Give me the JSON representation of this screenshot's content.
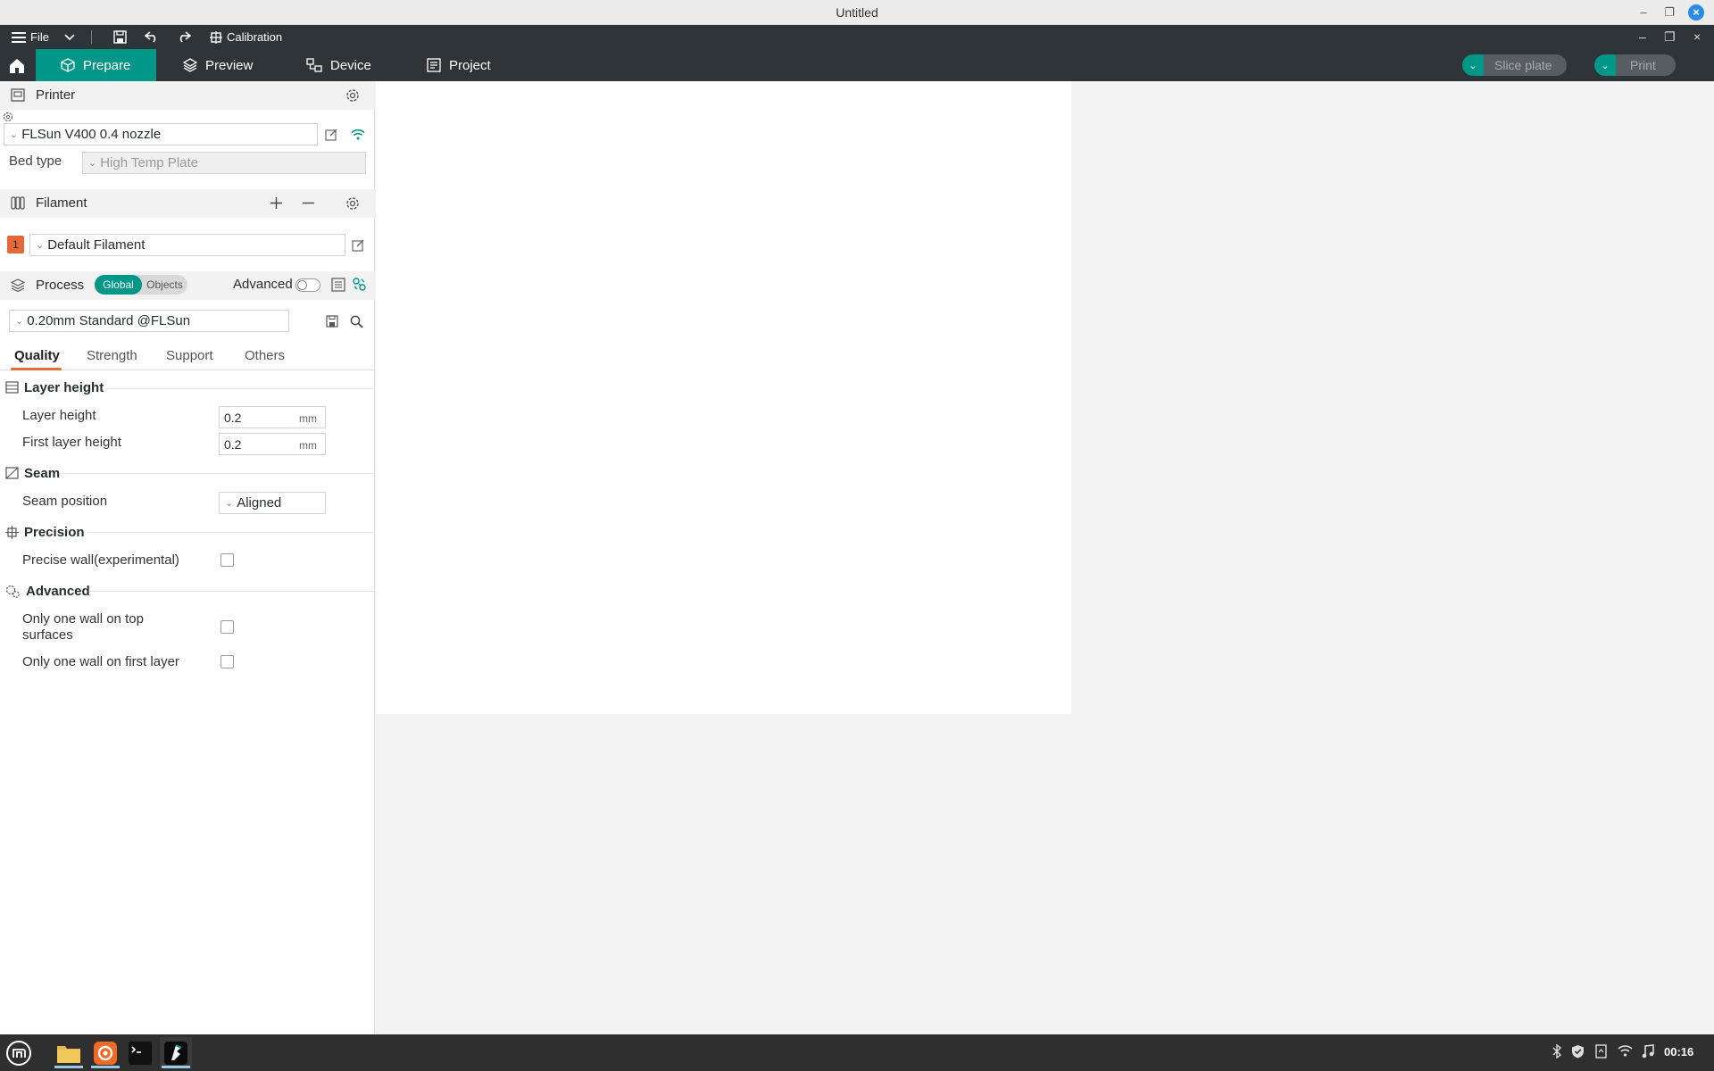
{
  "window": {
    "title": "Untitled"
  },
  "menubar": {
    "file_label": "File",
    "calibration_label": "Calibration"
  },
  "tabs": [
    {
      "label": "Prepare"
    },
    {
      "label": "Preview"
    },
    {
      "label": "Device"
    },
    {
      "label": "Project"
    }
  ],
  "actions": {
    "slice_label": "Slice plate",
    "print_label": "Print"
  },
  "printer": {
    "section_label": "Printer",
    "selected": "FLSun V400 0.4 nozzle",
    "bed_type_label": "Bed type",
    "bed_type_value": "High Temp Plate"
  },
  "filament": {
    "section_label": "Filament",
    "slot_number": "1",
    "slot_color": "#e5683a",
    "selected": "Default Filament"
  },
  "process": {
    "section_label": "Process",
    "global_label": "Global",
    "objects_label": "Objects",
    "advanced_label": "Advanced",
    "advanced_on": false,
    "preset": "0.20mm Standard @FLSun"
  },
  "subtabs": [
    "Quality",
    "Strength",
    "Support",
    "Others"
  ],
  "groups": {
    "layer_height": {
      "title": "Layer height",
      "layer_height_label": "Layer height",
      "layer_height_value": "0.2",
      "first_layer_label": "First layer height",
      "first_layer_value": "0.2",
      "unit": "mm"
    },
    "seam": {
      "title": "Seam",
      "position_label": "Seam position",
      "position_value": "Aligned"
    },
    "precision": {
      "title": "Precision",
      "precise_wall_label": "Precise wall(experimental)",
      "precise_wall_checked": false
    },
    "advanced": {
      "title": "Advanced",
      "one_wall_top_label": "Only one wall on top surfaces",
      "one_wall_top_checked": false,
      "one_wall_first_label": "Only one wall on first layer",
      "one_wall_first_checked": false
    }
  },
  "taskbar": {
    "clock": "00:16"
  },
  "colors": {
    "accent": "#009688",
    "dark_bar": "#2f3439",
    "highlight": "#e56c38"
  }
}
